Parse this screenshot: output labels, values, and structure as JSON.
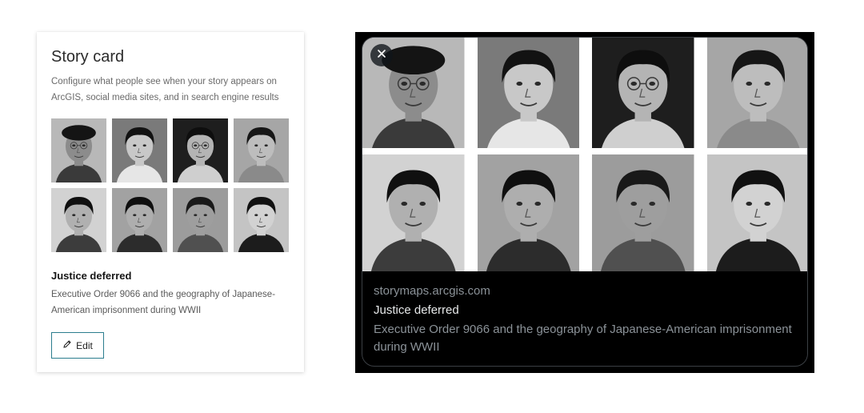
{
  "story_card": {
    "title": "Story card",
    "description": "Configure what people see when your story appears on ArcGIS, social media sites, and in search engine results",
    "card_title": "Justice deferred",
    "card_description": "Executive Order 9066 and the geography of Japanese-American imprisonment during WWII",
    "edit_label": "Edit",
    "edit_icon": "pencil-icon",
    "accent_color": "#2c7d8e"
  },
  "social_preview": {
    "close_icon": "close-icon",
    "domain": "storymaps.arcgis.com",
    "title": "Justice deferred",
    "description": "Executive Order 9066 and the geography of Japanese-American imprisonment during WWII",
    "background": "#000000",
    "text_color": "#e7e9ea",
    "muted_color": "#8b9298"
  },
  "portraits": [
    {
      "name": "man-with-cap",
      "bg": "#b8b8b8",
      "hair": "#141414",
      "skin": "#8c8c8c",
      "cloth": "#3a3a3a",
      "cap": true,
      "glasses": true
    },
    {
      "name": "girl-braids",
      "bg": "#7a7a7a",
      "hair": "#121212",
      "skin": "#c8c8c8",
      "cloth": "#e6e6e6",
      "cap": false,
      "glasses": false
    },
    {
      "name": "woman-glasses",
      "bg": "#1e1e1e",
      "hair": "#0e0e0e",
      "skin": "#b4b4b4",
      "cloth": "#cfcfcf",
      "cap": false,
      "glasses": true
    },
    {
      "name": "boy-smiling",
      "bg": "#a6a6a6",
      "hair": "#161616",
      "skin": "#bdbdbd",
      "cloth": "#8a8a8a",
      "cap": false,
      "glasses": false
    },
    {
      "name": "young-man",
      "bg": "#d2d2d2",
      "hair": "#101010",
      "skin": "#b0b0b0",
      "cloth": "#3c3c3c",
      "cap": false,
      "glasses": false
    },
    {
      "name": "young-woman",
      "bg": "#a2a2a2",
      "hair": "#0f0f0f",
      "skin": "#aeaeae",
      "cloth": "#2c2c2c",
      "cap": false,
      "glasses": false
    },
    {
      "name": "man-suit",
      "bg": "#9c9c9c",
      "hair": "#191919",
      "skin": "#9e9e9e",
      "cloth": "#505050",
      "cap": false,
      "glasses": false
    },
    {
      "name": "woman-smiling",
      "bg": "#c4c4c4",
      "hair": "#111111",
      "skin": "#d2d2d2",
      "cloth": "#1c1c1c",
      "cap": false,
      "glasses": false
    }
  ]
}
